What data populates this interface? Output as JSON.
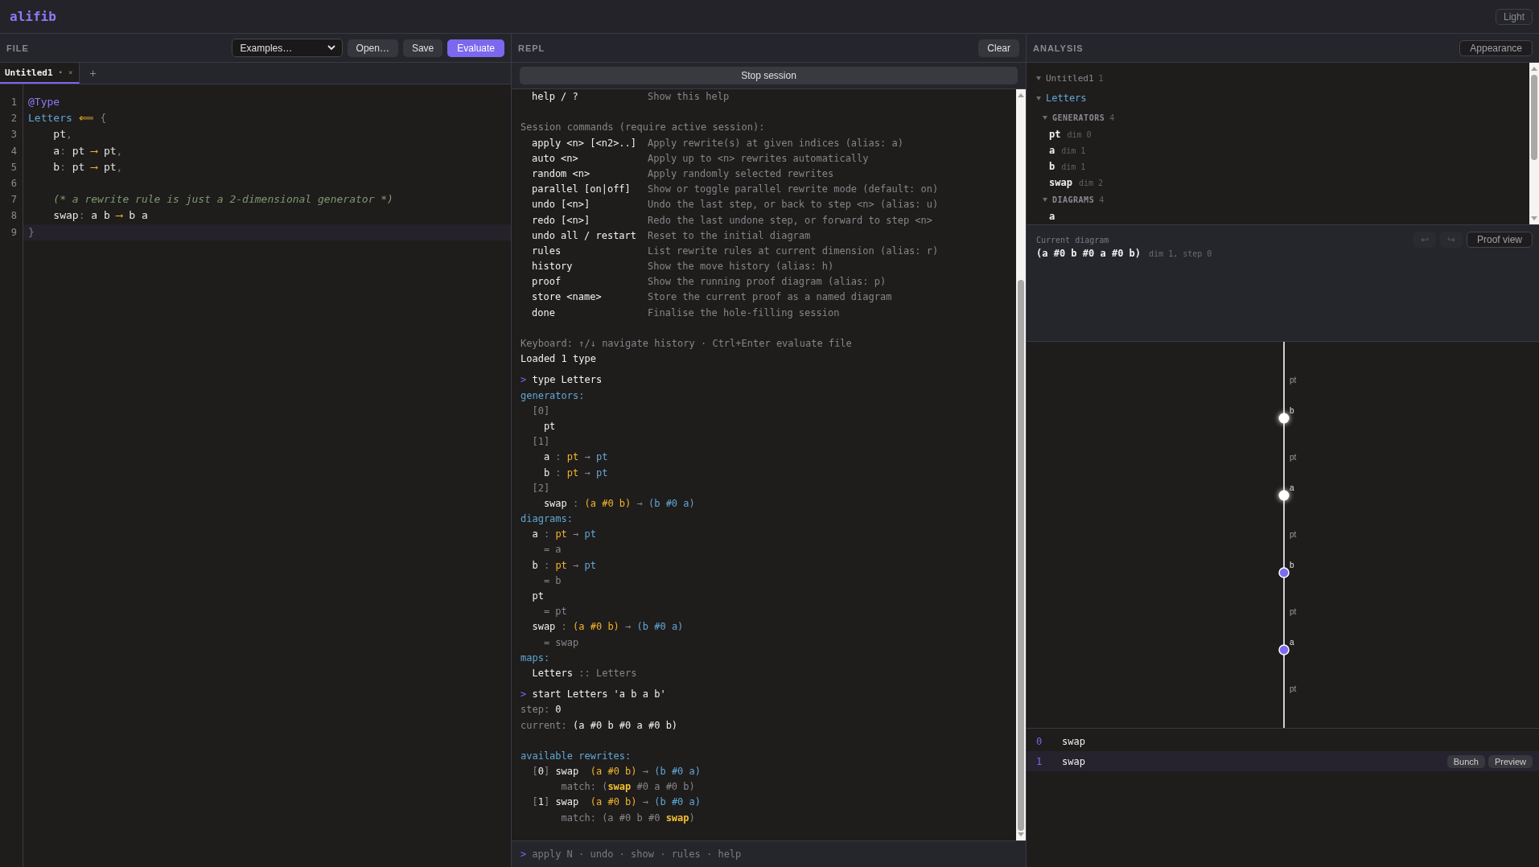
{
  "app": {
    "title": "alifib",
    "theme_button": "Light"
  },
  "file_panel": {
    "heading": "FILE",
    "examples": "Examples…",
    "buttons": [
      {
        "label": "Open…",
        "kind": "normal"
      },
      {
        "label": "Save",
        "kind": "normal"
      },
      {
        "label": "Evaluate",
        "kind": "primary"
      }
    ],
    "tabs": [
      {
        "label": "Untitled1",
        "modified_mark": "•",
        "close": "×",
        "selected": true
      }
    ],
    "new_tab": "+",
    "lines": [
      {
        "number": "1",
        "current": false,
        "segments": [
          {
            "text": "@Type",
            "kind": "directive"
          }
        ]
      },
      {
        "number": "2",
        "current": false,
        "segments": [
          {
            "text": "Letters",
            "kind": "name"
          },
          {
            "text": " ⟸",
            "kind": "op"
          },
          {
            "text": " {",
            "kind": "punct"
          }
        ]
      },
      {
        "number": "3",
        "current": false,
        "segments": [
          {
            "text": "    pt",
            "kind": "text"
          },
          {
            "text": ",",
            "kind": "punct"
          }
        ]
      },
      {
        "number": "4",
        "current": false,
        "segments": [
          {
            "text": "    a",
            "kind": "text"
          },
          {
            "text": ":",
            "kind": "punct"
          },
          {
            "text": " pt ",
            "kind": "text"
          },
          {
            "text": "⟶",
            "kind": "op"
          },
          {
            "text": " pt",
            "kind": "text"
          },
          {
            "text": ",",
            "kind": "punct"
          }
        ]
      },
      {
        "number": "5",
        "current": false,
        "segments": [
          {
            "text": "    b",
            "kind": "text"
          },
          {
            "text": ":",
            "kind": "punct"
          },
          {
            "text": " pt ",
            "kind": "text"
          },
          {
            "text": "⟶",
            "kind": "op"
          },
          {
            "text": " pt",
            "kind": "text"
          },
          {
            "text": ",",
            "kind": "punct"
          }
        ]
      },
      {
        "number": "6",
        "current": false
      },
      {
        "number": "7",
        "current": false,
        "segments": [
          {
            "text": "    (* a rewrite rule is just a 2-dimensional generator *)",
            "kind": "comment"
          }
        ]
      },
      {
        "number": "8",
        "current": false,
        "segments": [
          {
            "text": "    swap",
            "kind": "text"
          },
          {
            "text": ":",
            "kind": "punct"
          },
          {
            "text": " a b ",
            "kind": "text"
          },
          {
            "text": "⟶",
            "kind": "op"
          },
          {
            "text": " b a",
            "kind": "text"
          }
        ]
      },
      {
        "number": "9",
        "current": true,
        "segments": [
          {
            "text": "}",
            "kind": "punct"
          }
        ]
      }
    ]
  },
  "repl": {
    "heading": "REPL",
    "clear_button": "Clear",
    "stop_button": "Stop session",
    "lines": [
      {
        "kind": "help",
        "cmd": "help / ?",
        "desc": "Show this help"
      },
      {
        "kind": "blank"
      },
      {
        "kind": "text",
        "segments": [
          {
            "text": "Session commands (require active session):",
            "kind": "dim"
          }
        ]
      },
      {
        "kind": "help",
        "cmd": "apply <n> [<n2>..]",
        "desc": "Apply rewrite(s) at given indices (alias: a)"
      },
      {
        "kind": "help",
        "cmd": "auto <n>",
        "desc": "Apply up to <n> rewrites automatically"
      },
      {
        "kind": "help",
        "cmd": "random <n>",
        "desc": "Apply randomly selected rewrites"
      },
      {
        "kind": "help",
        "cmd": "parallel [on|off]",
        "desc": "Show or toggle parallel rewrite mode (default: on)"
      },
      {
        "kind": "help",
        "cmd": "undo [<n>]",
        "desc": "Undo the last step, or back to step <n> (alias: u)"
      },
      {
        "kind": "help",
        "cmd": "redo [<n>]",
        "desc": "Redo the last undone step, or forward to step <n>"
      },
      {
        "kind": "help",
        "cmd": "undo all / restart",
        "desc": "Reset to the initial diagram"
      },
      {
        "kind": "help",
        "cmd": "rules",
        "desc": "List rewrite rules at current dimension (alias: r)"
      },
      {
        "kind": "help",
        "cmd": "history",
        "desc": "Show the move history (alias: h)"
      },
      {
        "kind": "help",
        "cmd": "proof",
        "desc": "Show the running proof diagram (alias: p)"
      },
      {
        "kind": "help",
        "cmd": "store <name>",
        "desc": "Store the current proof as a named diagram"
      },
      {
        "kind": "help",
        "cmd": "done",
        "desc": "Finalise the hole-filling session"
      },
      {
        "kind": "blank"
      },
      {
        "kind": "text",
        "segments": [
          {
            "text": "Keyboard: ↑/↓ navigate history · Ctrl+Enter evaluate file",
            "kind": "dim"
          }
        ]
      },
      {
        "kind": "text",
        "segments": [
          {
            "text": "Loaded 1 type",
            "kind": "plain"
          }
        ]
      },
      {
        "kind": "prompt",
        "segments": [
          {
            "text": ">",
            "kind": "prompt"
          },
          {
            "text": " type Letters",
            "kind": "plain"
          }
        ]
      },
      {
        "kind": "text",
        "segments": [
          {
            "text": "generators:",
            "kind": "heading"
          }
        ]
      },
      {
        "kind": "text",
        "segments": [
          {
            "text": "  [0]",
            "kind": "dim"
          }
        ]
      },
      {
        "kind": "text",
        "segments": [
          {
            "text": "    pt",
            "kind": "plain"
          }
        ]
      },
      {
        "kind": "text",
        "segments": [
          {
            "text": "  [1]",
            "kind": "dim"
          }
        ]
      },
      {
        "kind": "text",
        "segments": [
          {
            "text": "    a",
            "kind": "plain"
          },
          {
            "text": " : ",
            "kind": "dim"
          },
          {
            "text": "pt",
            "kind": "src"
          },
          {
            "text": " → ",
            "kind": "dim"
          },
          {
            "text": "pt",
            "kind": "tgt"
          }
        ]
      },
      {
        "kind": "text",
        "segments": [
          {
            "text": "    b",
            "kind": "plain"
          },
          {
            "text": " : ",
            "kind": "dim"
          },
          {
            "text": "pt",
            "kind": "src"
          },
          {
            "text": " → ",
            "kind": "dim"
          },
          {
            "text": "pt",
            "kind": "tgt"
          }
        ]
      },
      {
        "kind": "text",
        "segments": [
          {
            "text": "  [2]",
            "kind": "dim"
          }
        ]
      },
      {
        "kind": "text",
        "segments": [
          {
            "text": "    swap",
            "kind": "plain"
          },
          {
            "text": " : ",
            "kind": "dim"
          },
          {
            "text": "(a #0 b)",
            "kind": "src"
          },
          {
            "text": " → ",
            "kind": "dim"
          },
          {
            "text": "(b #0 a)",
            "kind": "tgt"
          }
        ]
      },
      {
        "kind": "text",
        "segments": [
          {
            "text": "diagrams:",
            "kind": "heading"
          }
        ]
      },
      {
        "kind": "text",
        "segments": [
          {
            "text": "  a",
            "kind": "plain"
          },
          {
            "text": " : ",
            "kind": "dim"
          },
          {
            "text": "pt",
            "kind": "src"
          },
          {
            "text": " → ",
            "kind": "dim"
          },
          {
            "text": "pt",
            "kind": "tgt"
          }
        ]
      },
      {
        "kind": "text",
        "segments": [
          {
            "text": "    = a",
            "kind": "dim"
          }
        ]
      },
      {
        "kind": "text",
        "segments": [
          {
            "text": "  b",
            "kind": "plain"
          },
          {
            "text": " : ",
            "kind": "dim"
          },
          {
            "text": "pt",
            "kind": "src"
          },
          {
            "text": " → ",
            "kind": "dim"
          },
          {
            "text": "pt",
            "kind": "tgt"
          }
        ]
      },
      {
        "kind": "text",
        "segments": [
          {
            "text": "    = b",
            "kind": "dim"
          }
        ]
      },
      {
        "kind": "text",
        "segments": [
          {
            "text": "  pt",
            "kind": "plain"
          }
        ]
      },
      {
        "kind": "text",
        "segments": [
          {
            "text": "    = pt",
            "kind": "dim"
          }
        ]
      },
      {
        "kind": "text",
        "segments": [
          {
            "text": "  swap",
            "kind": "plain"
          },
          {
            "text": " : ",
            "kind": "dim"
          },
          {
            "text": "(a #0 b)",
            "kind": "src"
          },
          {
            "text": " → ",
            "kind": "dim"
          },
          {
            "text": "(b #0 a)",
            "kind": "tgt"
          }
        ]
      },
      {
        "kind": "text",
        "segments": [
          {
            "text": "    = swap",
            "kind": "dim"
          }
        ]
      },
      {
        "kind": "text",
        "segments": [
          {
            "text": "maps:",
            "kind": "heading"
          }
        ]
      },
      {
        "kind": "text",
        "segments": [
          {
            "text": "  Letters",
            "kind": "plain"
          },
          {
            "text": " :: Letters",
            "kind": "dim"
          }
        ]
      },
      {
        "kind": "prompt",
        "segments": [
          {
            "text": ">",
            "kind": "prompt"
          },
          {
            "text": " start Letters 'a b a b'",
            "kind": "plain"
          }
        ]
      },
      {
        "kind": "text",
        "segments": [
          {
            "text": "step: ",
            "kind": "dim"
          },
          {
            "text": "0",
            "kind": "plain"
          }
        ]
      },
      {
        "kind": "text",
        "segments": [
          {
            "text": "current: ",
            "kind": "dim"
          },
          {
            "text": "(a #0 b #0 a #0 b)",
            "kind": "plain"
          }
        ]
      },
      {
        "kind": "blank"
      },
      {
        "kind": "text",
        "segments": [
          {
            "text": "available rewrites:",
            "kind": "heading"
          }
        ]
      },
      {
        "kind": "text",
        "segments": [
          {
            "text": "  [",
            "kind": "dim"
          },
          {
            "text": "0",
            "kind": "plain"
          },
          {
            "text": "] ",
            "kind": "dim"
          },
          {
            "text": "swap  ",
            "kind": "plain"
          },
          {
            "text": "(a #0 b)",
            "kind": "src"
          },
          {
            "text": " → ",
            "kind": "dim"
          },
          {
            "text": "(b #0 a)",
            "kind": "tgt"
          }
        ]
      },
      {
        "kind": "text",
        "segments": [
          {
            "text": "       match: (",
            "kind": "dim"
          },
          {
            "text": "swap",
            "kind": "strong"
          },
          {
            "text": " #0 a #0 b)",
            "kind": "dim"
          }
        ]
      },
      {
        "kind": "text",
        "segments": [
          {
            "text": "  [",
            "kind": "dim"
          },
          {
            "text": "1",
            "kind": "plain"
          },
          {
            "text": "] ",
            "kind": "dim"
          },
          {
            "text": "swap  ",
            "kind": "plain"
          },
          {
            "text": "(a #0 b)",
            "kind": "src"
          },
          {
            "text": " → ",
            "kind": "dim"
          },
          {
            "text": "(b #0 a)",
            "kind": "tgt"
          }
        ]
      },
      {
        "kind": "text",
        "segments": [
          {
            "text": "       match: (a #0 b #0 ",
            "kind": "dim"
          },
          {
            "text": "swap",
            "kind": "strong"
          },
          {
            "text": ")",
            "kind": "dim"
          }
        ]
      }
    ],
    "prompt": ">",
    "input_placeholder": "apply N · undo · show · rules · help"
  },
  "analysis": {
    "heading": "ANALYSIS",
    "appearance_button": "Appearance",
    "tree": [
      {
        "kind": "file",
        "label": "Untitled1",
        "count": "1",
        "expanded": true,
        "children": [
          {
            "kind": "type",
            "label": "Letters",
            "expanded": true,
            "children": [
              {
                "kind": "section",
                "label": "GENERATORS",
                "count": "4",
                "expanded": true,
                "children": [
                  {
                    "kind": "item",
                    "label": "pt",
                    "detail": "dim 0"
                  },
                  {
                    "kind": "item",
                    "label": "a",
                    "detail": "dim 1"
                  },
                  {
                    "kind": "item",
                    "label": "b",
                    "detail": "dim 1"
                  },
                  {
                    "kind": "item",
                    "label": "swap",
                    "detail": "dim 2"
                  }
                ]
              },
              {
                "kind": "section",
                "label": "DIAGRAMS",
                "count": "4",
                "expanded": true,
                "children": [
                  {
                    "kind": "item",
                    "label": "a"
                  }
                ]
              }
            ]
          }
        ]
      }
    ],
    "current": {
      "label": "Current diagram",
      "value": "(a #0 b #0 a #0 b)",
      "detail": "dim 1, step 0",
      "buttons": [
        {
          "label": "↩",
          "kind": "icon",
          "disabled": true
        },
        {
          "label": "↪",
          "kind": "icon",
          "disabled": true
        },
        {
          "label": "Proof view",
          "kind": "text",
          "disabled": false
        }
      ]
    },
    "diagram": {
      "items": [
        {
          "kind": "wire",
          "label": "pt"
        },
        {
          "kind": "node",
          "label": "b",
          "highlighted": true
        },
        {
          "kind": "wire",
          "label": "pt"
        },
        {
          "kind": "node",
          "label": "a",
          "highlighted": true
        },
        {
          "kind": "wire",
          "label": "pt"
        },
        {
          "kind": "node",
          "label": "b",
          "highlighted": false
        },
        {
          "kind": "wire",
          "label": "pt"
        },
        {
          "kind": "node",
          "label": "a",
          "highlighted": false
        },
        {
          "kind": "wire",
          "label": "pt"
        }
      ]
    },
    "rewrites": [
      {
        "index": "0",
        "name": "swap",
        "selected": false
      },
      {
        "index": "1",
        "name": "swap",
        "selected": true,
        "actions": [
          "Bunch",
          "Preview"
        ]
      }
    ]
  }
}
